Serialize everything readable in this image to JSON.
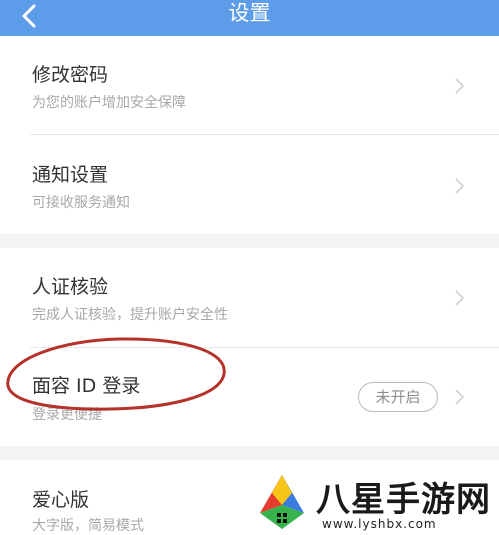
{
  "header": {
    "title": "设置"
  },
  "groups": [
    {
      "items": [
        {
          "title": "修改密码",
          "subtitle": "为您的账户增加安全保障"
        },
        {
          "title": "通知设置",
          "subtitle": "可接收服务通知"
        }
      ]
    },
    {
      "items": [
        {
          "title": "人证核验",
          "subtitle": "完成人证核验，提升账户安全性"
        },
        {
          "title": "面容 ID 登录",
          "subtitle": "登录更便捷",
          "badge": "未开启"
        }
      ]
    },
    {
      "items": [
        {
          "title": "爱心版",
          "subtitle": "大字版，简易模式"
        }
      ]
    }
  ],
  "watermark": {
    "text": "八星手游网",
    "url": "www.lyshbx.com"
  },
  "colors": {
    "header_bg": "#5c9ce9",
    "annotation": "#b5322a"
  },
  "icons": {
    "back": "chevron-left-icon",
    "row_arrow": "chevron-right-icon"
  }
}
